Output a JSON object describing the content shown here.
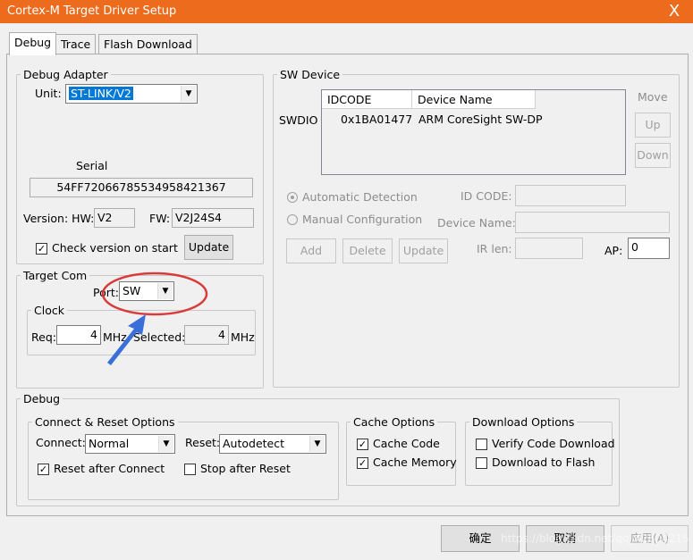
{
  "window": {
    "title": "Cortex-M Target Driver Setup",
    "close": "X"
  },
  "tabs": [
    "Debug",
    "Trace",
    "Flash Download"
  ],
  "debug_adapter": {
    "legend": "Debug Adapter",
    "unit_label": "Unit:",
    "unit_value": "ST-LINK/V2",
    "serial_label": "Serial",
    "serial_value": "54FF72066785534958421367",
    "version_label": "Version: HW:",
    "hw_value": "V2",
    "fw_label": "FW:",
    "fw_value": "V2J24S4",
    "check_version_label": "Check version on start",
    "check_version_checked": true,
    "update_label": "Update"
  },
  "target_com": {
    "legend": "Target Com",
    "port_label": "Port:",
    "port_value": "SW",
    "clock_legend": "Clock",
    "req_label": "Req:",
    "req_value": "4",
    "req_unit": "MHz",
    "selected_label": "Selected:",
    "selected_value": "4",
    "selected_unit": "MHz"
  },
  "sw_device": {
    "legend": "SW Device",
    "columns": [
      "IDCODE",
      "Device Name"
    ],
    "row_label": "SWDIO",
    "rows": [
      {
        "idcode": "0x1BA01477",
        "name": "ARM CoreSight SW-DP"
      }
    ],
    "move_label": "Move",
    "up_label": "Up",
    "down_label": "Down",
    "auto_detect_label": "Automatic Detection",
    "manual_config_label": "Manual Configuration",
    "id_code_label": "ID CODE:",
    "device_name_label": "Device Name:",
    "ir_len_label": "IR len:",
    "ap_label": "AP:",
    "ap_value": "0",
    "add_label": "Add",
    "delete_label": "Delete",
    "update_label": "Update"
  },
  "debug_section": {
    "legend": "Debug",
    "connect_reset": {
      "legend": "Connect & Reset Options",
      "connect_label": "Connect:",
      "connect_value": "Normal",
      "reset_label": "Reset:",
      "reset_value": "Autodetect",
      "reset_after_connect_label": "Reset after Connect",
      "reset_after_connect_checked": true,
      "stop_after_reset_label": "Stop after Reset",
      "stop_after_reset_checked": false
    },
    "cache": {
      "legend": "Cache Options",
      "cache_code_label": "Cache Code",
      "cache_code_checked": true,
      "cache_memory_label": "Cache Memory",
      "cache_memory_checked": true
    },
    "download": {
      "legend": "Download Options",
      "verify_label": "Verify Code Download",
      "verify_checked": false,
      "download_flash_label": "Download to Flash",
      "download_flash_checked": false
    }
  },
  "footer": {
    "ok": "确定",
    "cancel": "取消",
    "apply": "应用(A)"
  },
  "annotation": {
    "color": "#d93a3a",
    "arrow_color": "#3b6fd8"
  },
  "watermark": "https://blog.csdn.net/qq_42604215"
}
